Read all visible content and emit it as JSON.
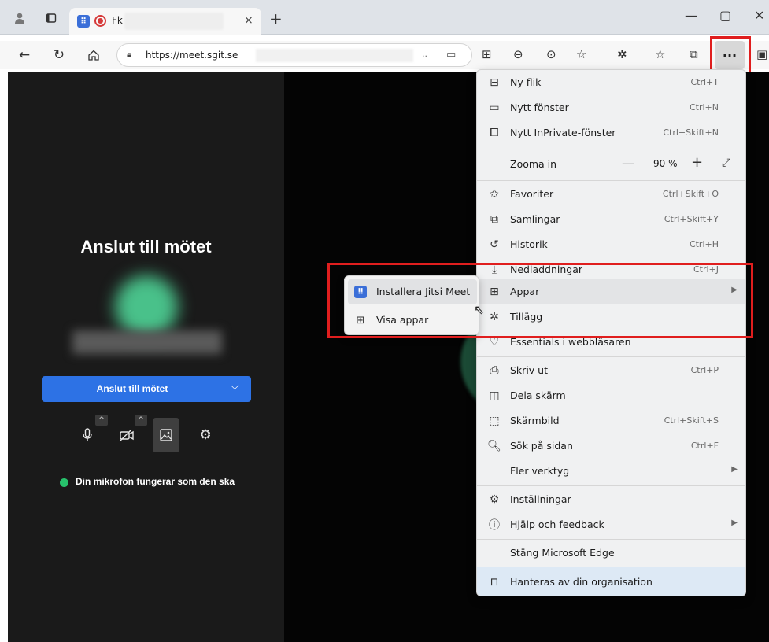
{
  "browser": {
    "tab": {
      "title": "Fk",
      "close_icon": "×"
    },
    "new_tab_icon": "+",
    "window_controls": {
      "minimize": "—",
      "maximize": "▢",
      "close": "✕"
    },
    "url": "https://meet.sgit.se",
    "url_ellipsis": "..",
    "more_button": "···"
  },
  "page": {
    "join_title": "Anslut till mötet",
    "join_button": "Anslut till mötet",
    "mic_status": "Din mikrofon fungerar som den ska",
    "status_color": "#27c26c",
    "accent_color": "#2d72e5"
  },
  "menu": {
    "items": [
      {
        "label": "Ny flik",
        "shortcut": "Ctrl+T"
      },
      {
        "label": "Nytt fönster",
        "shortcut": "Ctrl+N"
      },
      {
        "label": "Nytt InPrivate-fönster",
        "shortcut": "Ctrl+Skift+N"
      },
      {
        "label": "Favoriter",
        "shortcut": "Ctrl+Skift+O"
      },
      {
        "label": "Samlingar",
        "shortcut": "Ctrl+Skift+Y"
      },
      {
        "label": "Historik",
        "shortcut": "Ctrl+H"
      },
      {
        "label": "Nedladdningar",
        "shortcut": "Ctrl+J"
      },
      {
        "label": "Appar",
        "shortcut": ""
      },
      {
        "label": "Tillägg",
        "shortcut": ""
      },
      {
        "label": "Essentials i webbläsaren",
        "shortcut": ""
      },
      {
        "label": "Skriv ut",
        "shortcut": "Ctrl+P"
      },
      {
        "label": "Dela skärm",
        "shortcut": ""
      },
      {
        "label": "Skärmbild",
        "shortcut": "Ctrl+Skift+S"
      },
      {
        "label": "Sök på sidan",
        "shortcut": "Ctrl+F"
      },
      {
        "label": "Fler verktyg",
        "shortcut": ""
      },
      {
        "label": "Inställningar",
        "shortcut": ""
      },
      {
        "label": "Hjälp och feedback",
        "shortcut": ""
      },
      {
        "label": "Stäng Microsoft Edge",
        "shortcut": ""
      },
      {
        "label": "Hanteras av din organisation",
        "shortcut": ""
      }
    ],
    "zoom": {
      "label": "Zooma in",
      "value": "90 %",
      "minus": "—",
      "plus": "+"
    }
  },
  "submenu": {
    "items": [
      {
        "label": "Installera Jitsi Meet"
      },
      {
        "label": "Visa appar"
      }
    ]
  }
}
